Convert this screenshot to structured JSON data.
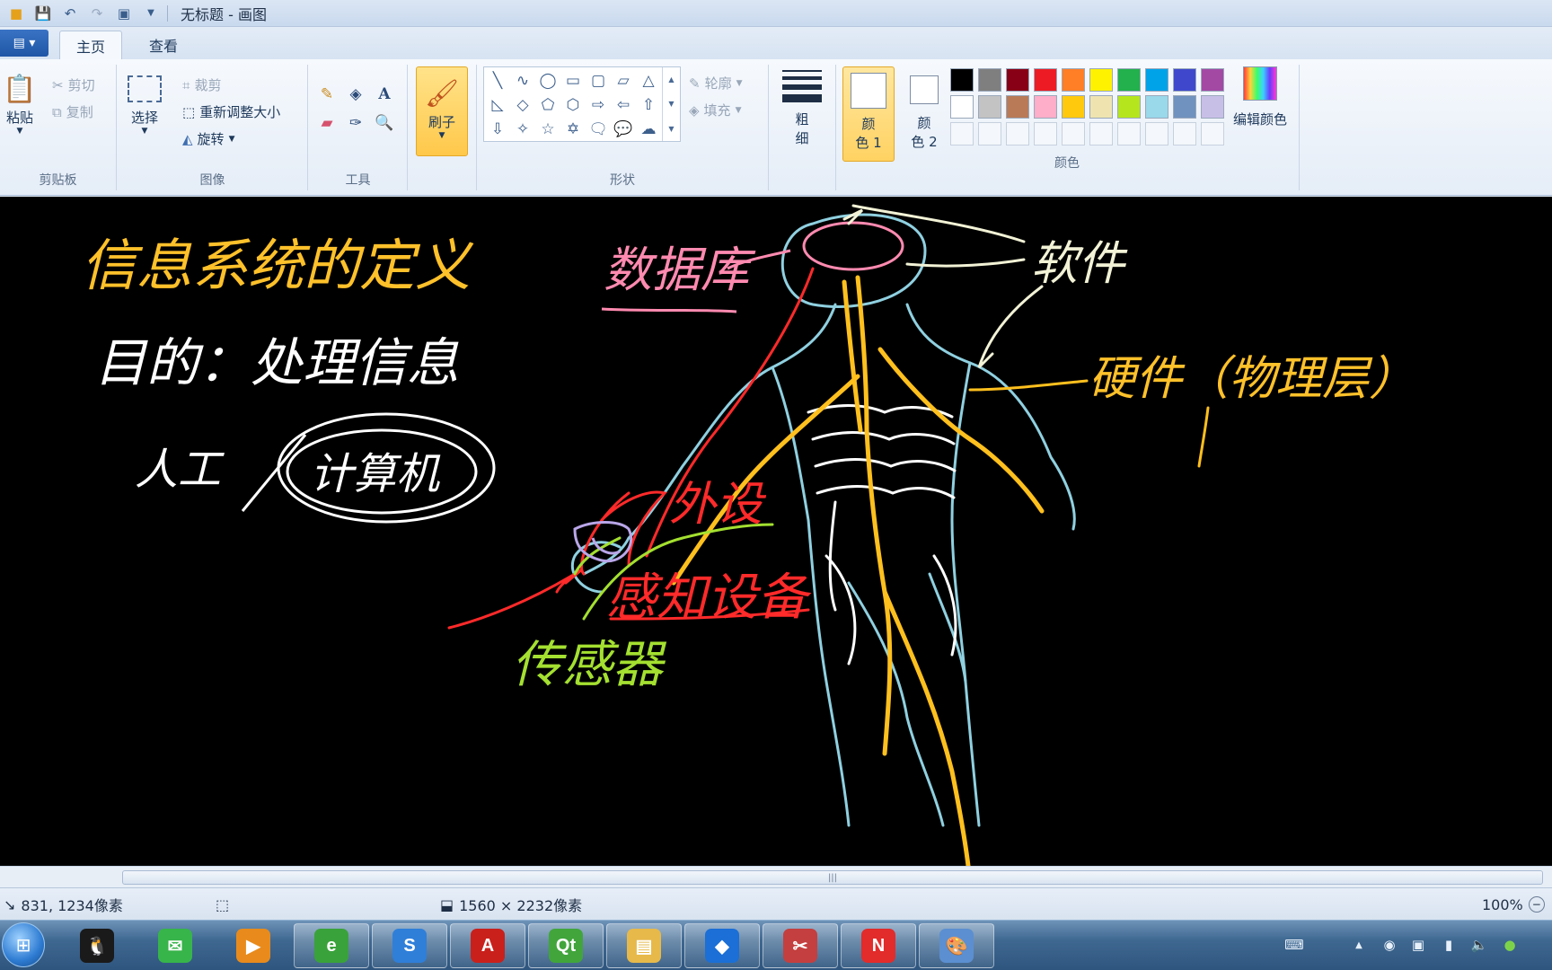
{
  "window": {
    "title": "无标题 - 画图"
  },
  "tabs": [
    {
      "label": "主页",
      "active": true
    },
    {
      "label": "查看",
      "active": false
    }
  ],
  "ribbon": {
    "clipboard": {
      "group_label": "剪贴板",
      "paste_label": "粘贴",
      "cut_label": "剪切",
      "copy_label": "复制"
    },
    "image": {
      "group_label": "图像",
      "select_label": "选择",
      "crop_label": "裁剪",
      "resize_label": "重新调整大小",
      "rotate_label": "旋转"
    },
    "tools": {
      "group_label": "工具"
    },
    "brush": {
      "label": "刷子"
    },
    "shapes": {
      "group_label": "形状",
      "outline_label": "轮廓",
      "fill_label": "填充"
    },
    "size": {
      "label_top": "粗",
      "label_bottom": "细"
    },
    "colors": {
      "group_label": "颜色",
      "color1_top": "颜",
      "color1_bottom": "色 1",
      "color2_top": "颜",
      "color2_bottom": "色 2",
      "edit_label": "编辑颜色",
      "color1_value": "#ffffff",
      "color2_value": "#ffffff",
      "palette_row1": [
        "#000000",
        "#7f7f7f",
        "#880015",
        "#ed1c24",
        "#ff7f27",
        "#fff200",
        "#22b14c",
        "#00a2e8",
        "#3f48cc",
        "#a349a4"
      ],
      "palette_row2": [
        "#ffffff",
        "#c3c3c3",
        "#b97a57",
        "#ffaec9",
        "#ffc90e",
        "#efe4b0",
        "#b5e61d",
        "#99d9ea",
        "#7092be",
        "#c8bfe7"
      ]
    }
  },
  "statusbar": {
    "cursor_pos": "831, 1234像素",
    "canvas_size": "1560 × 2232像素",
    "zoom": "100%"
  },
  "taskbar": {
    "apps": [
      {
        "name": "qq",
        "color": "#1a1a1a",
        "glyph": "🐧",
        "open": false
      },
      {
        "name": "wechat",
        "color": "#37b44a",
        "glyph": "✉",
        "open": false
      },
      {
        "name": "media-player",
        "color": "#e88b1c",
        "glyph": "▶",
        "open": false
      },
      {
        "name": "browser",
        "color": "#3aa23a",
        "glyph": "e",
        "open": true
      },
      {
        "name": "sogou",
        "color": "#2f7fd9",
        "glyph": "S",
        "open": true
      },
      {
        "name": "pdf-reader",
        "color": "#c9201c",
        "glyph": "A",
        "open": true
      },
      {
        "name": "qt-creator",
        "color": "#41a53c",
        "glyph": "Qt",
        "open": true
      },
      {
        "name": "file-explorer",
        "color": "#e6b94a",
        "glyph": "▤",
        "open": true
      },
      {
        "name": "feishu",
        "color": "#1b6fd6",
        "glyph": "◆",
        "open": true
      },
      {
        "name": "snipping-tool",
        "color": "#c43f3f",
        "glyph": "✂",
        "open": true
      },
      {
        "name": "notes-n",
        "color": "#e22b2b",
        "glyph": "N",
        "open": true
      },
      {
        "name": "paint",
        "color": "#5b8fd1",
        "glyph": "🎨",
        "open": true
      }
    ]
  },
  "canvas_drawing": {
    "text_lines": [
      "信息系统的定义",
      "目的：处理信息",
      "人工",
      "计算机",
      "数据库",
      "软件",
      "硬件（物理层）",
      "外设",
      "感知设备",
      "传感器"
    ]
  }
}
